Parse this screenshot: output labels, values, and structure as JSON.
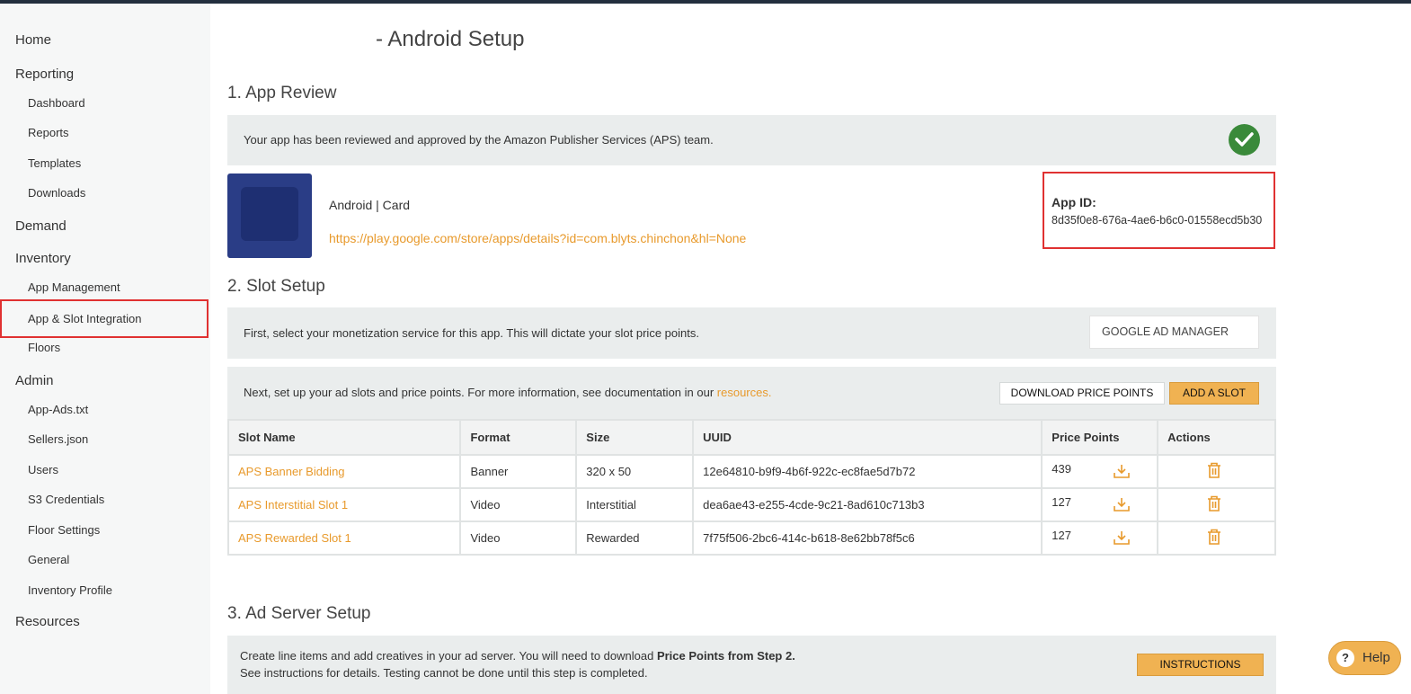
{
  "sidebar": {
    "items": [
      {
        "label": "Home",
        "level": "top"
      },
      {
        "label": "Reporting",
        "level": "top"
      },
      {
        "label": "Dashboard",
        "level": "sub"
      },
      {
        "label": "Reports",
        "level": "sub"
      },
      {
        "label": "Templates",
        "level": "sub"
      },
      {
        "label": "Downloads",
        "level": "sub"
      },
      {
        "label": "Demand",
        "level": "top"
      },
      {
        "label": "Inventory",
        "level": "top"
      },
      {
        "label": "App Management",
        "level": "sub"
      },
      {
        "label": "App & Slot Integration",
        "level": "sub",
        "active": true
      },
      {
        "label": "Floors",
        "level": "sub"
      },
      {
        "label": "Admin",
        "level": "top"
      },
      {
        "label": "App-Ads.txt",
        "level": "sub"
      },
      {
        "label": "Sellers.json",
        "level": "sub"
      },
      {
        "label": "Users",
        "level": "sub"
      },
      {
        "label": "S3 Credentials",
        "level": "sub"
      },
      {
        "label": "Floor Settings",
        "level": "sub"
      },
      {
        "label": "General",
        "level": "sub"
      },
      {
        "label": "Inventory Profile",
        "level": "sub"
      },
      {
        "label": "Resources",
        "level": "top"
      }
    ]
  },
  "page": {
    "title": "- Android Setup"
  },
  "app_review": {
    "heading": "1. App Review",
    "status_text": "Your app has been reviewed and approved by the Amazon Publisher Services (APS) team.",
    "status_icon": "checkmark-icon",
    "platform_text": "Android | Card",
    "store_url": "https://play.google.com/store/apps/details?id=com.blyts.chinchon&hl=None",
    "app_id_label": "App ID:",
    "app_id_value": "8d35f0e8-676a-4ae6-b6c0-01558ecd5b30"
  },
  "slot_setup": {
    "heading": "2. Slot Setup",
    "monetization_text": "First, select your monetization service for this app. This will dictate your slot price points.",
    "monetization_selected": "GOOGLE AD MANAGER",
    "instructions_text": "Next, set up your ad slots and price points. For more information, see documentation in our ",
    "resources_link": "resources.",
    "download_button": "DOWNLOAD PRICE POINTS",
    "add_slot_button": "ADD A SLOT",
    "columns": [
      "Slot Name",
      "Format",
      "Size",
      "UUID",
      "Price Points",
      "Actions"
    ],
    "rows": [
      {
        "name": "APS Banner Bidding",
        "format": "Banner",
        "size": "320 x 50",
        "uuid": "12e64810-b9f9-4b6f-922c-ec8fae5d7b72",
        "price_points": "439"
      },
      {
        "name": "APS Interstitial Slot 1",
        "format": "Video",
        "size": "Interstitial",
        "uuid": "dea6ae43-e255-4cde-9c21-8ad610c713b3",
        "price_points": "127"
      },
      {
        "name": "APS Rewarded Slot 1",
        "format": "Video",
        "size": "Rewarded",
        "uuid": "7f75f506-2bc6-414c-b618-8e62bb78f5c6",
        "price_points": "127"
      }
    ]
  },
  "ad_server": {
    "heading": "3. Ad Server Setup",
    "line1_prefix": "Create line items and add creatives in your ad server. You will need to download ",
    "line1_bold": "Price Points from Step 2.",
    "line2": "See instructions for details. Testing cannot be done until this step is completed.",
    "instructions_button": "INSTRUCTIONS"
  },
  "help": {
    "icon": "?",
    "label": "Help"
  },
  "colors": {
    "accent": "#e89a2c",
    "button_orange": "#f0b252",
    "success": "#3a8a3a",
    "highlight": "#e03131"
  }
}
